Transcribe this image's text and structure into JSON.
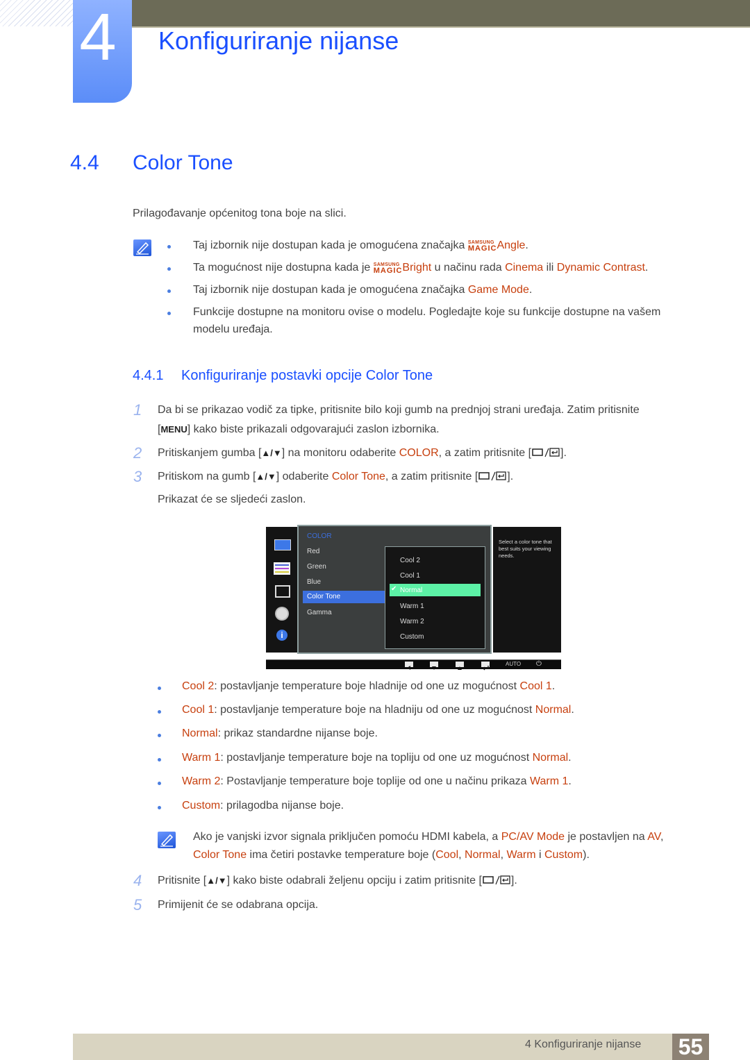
{
  "chapter": {
    "number": "4",
    "title": "Konfiguriranje nijanse"
  },
  "section": {
    "number": "4.4",
    "title": "Color Tone",
    "intro": "Prilagođavanje općenitog tona boje na slici."
  },
  "notes": [
    {
      "pre": "Taj izbornik nije dostupan kada je omogućena značajka ",
      "magic_top": "SAMSUNG",
      "magic_bottom": "MAGIC",
      "hl1": "Angle",
      "post": "."
    },
    {
      "pre": "Ta mogućnost nije dostupna kada je ",
      "magic_top": "SAMSUNG",
      "magic_bottom": "MAGIC",
      "hl1": "Bright",
      "mid": " u načinu rada ",
      "hl2": "Cinema",
      "mid2": " ili ",
      "hl3": "Dynamic Contrast",
      "post": "."
    },
    {
      "pre": "Taj izbornik nije dostupan kada je omogućena značajka ",
      "hl1": "Game Mode",
      "post": "."
    },
    {
      "line1": "Funkcije dostupne na monitoru ovise o modelu. Pogledajte koje su funkcije dostupne na vašem",
      "line2": "modelu uređaja."
    }
  ],
  "subsection": {
    "number": "4.4.1",
    "title": "Konfiguriranje postavki opcije Color Tone"
  },
  "steps": [
    {
      "n": "1",
      "line1": "Da bi se prikazao vodič za tipke, pritisnite bilo koji gumb na prednjoj strani uređaja. Zatim pritisnite",
      "key": "MENU",
      "line2": "kako biste prikazali odgovarajući zaslon izbornika."
    },
    {
      "n": "2",
      "pre": "Pritiskanjem gumba [",
      "arrows": "▲/▼",
      "mid": "] na monitoru odaberite ",
      "hl": "COLOR",
      "post": ", a zatim pritisnite ["
    },
    {
      "n": "3",
      "pre": "Pritiskom na gumb [",
      "arrows": "▲/▼",
      "mid": "] odaberite ",
      "hl": "Color Tone",
      "post": ", a zatim pritisnite [",
      "after": "Prikazat će se sljedeći zaslon."
    },
    {
      "n": "4",
      "pre": "Pritisnite [",
      "arrows": "▲/▼",
      "mid": "] kako biste odabrali željenu opciju i zatim pritisnite ["
    },
    {
      "n": "5",
      "text": "Primijenit će se odabrana opcija."
    }
  ],
  "osd": {
    "menu_title": "COLOR",
    "menu_items": [
      "Red",
      "Green",
      "Blue",
      "Color Tone",
      "Gamma"
    ],
    "selected_menu_item": "Color Tone",
    "options": [
      "Cool 2",
      "Cool 1",
      "Normal",
      "Warm 1",
      "Warm 2",
      "Custom"
    ],
    "selected_option": "Normal",
    "help_text": "Select a color tone that best suits your viewing needs.",
    "bottom_auto": "AUTO",
    "side_icons": [
      "monitor-icon",
      "sliders-icon",
      "resize-icon",
      "gear-icon",
      "info-icon"
    ],
    "colors": {
      "selected_item": "#3c6fde",
      "selected_option": "#5cf1a6",
      "title": "#3c6fde"
    }
  },
  "descriptions": [
    {
      "name": "Cool 2",
      "text": ": postavljanje temperature boje hladnije od one uz mogućnost ",
      "ref": "Cool 1",
      "end": "."
    },
    {
      "name": "Cool 1",
      "text": ": postavljanje temperature boje na hladniju od one uz mogućnost ",
      "ref": "Normal",
      "end": "."
    },
    {
      "name": "Normal",
      "text": ": prikaz standardne nijanse boje.",
      "ref": "",
      "end": ""
    },
    {
      "name": "Warm 1",
      "text": ": postavljanje temperature boje na topliju od one uz mogućnost ",
      "ref": "Normal",
      "end": "."
    },
    {
      "name": "Warm 2",
      "text": ": Postavljanje temperature boje toplije od one u načinu prikaza ",
      "ref": "Warm 1",
      "end": "."
    },
    {
      "name": "Custom",
      "text": ": prilagodba nijanse boje.",
      "ref": "",
      "end": ""
    }
  ],
  "hdmi_note": {
    "t1": "Ako je vanjski izvor signala priključen pomoću HDMI kabela, a ",
    "h1": "PC/AV Mode",
    "t2": " je postavljen na ",
    "h2": "AV",
    "t3": ",",
    "h3": "Color Tone",
    "t4": " ima četiri postavke temperature boje (",
    "h4": "Cool",
    "t5": ", ",
    "h5": "Normal",
    "t6": ", ",
    "h6": "Warm",
    "t7": " i ",
    "h7": "Custom",
    "t8": ")."
  },
  "footer": {
    "chapter_label": "4 Konfiguriranje nijanse",
    "page": "55"
  },
  "colors": {
    "heading_blue": "#1a4fff",
    "highlight": "#c7400f",
    "topbar": "#6c6b57",
    "footer": "#d9d4c1",
    "page_box": "#8d8274"
  }
}
